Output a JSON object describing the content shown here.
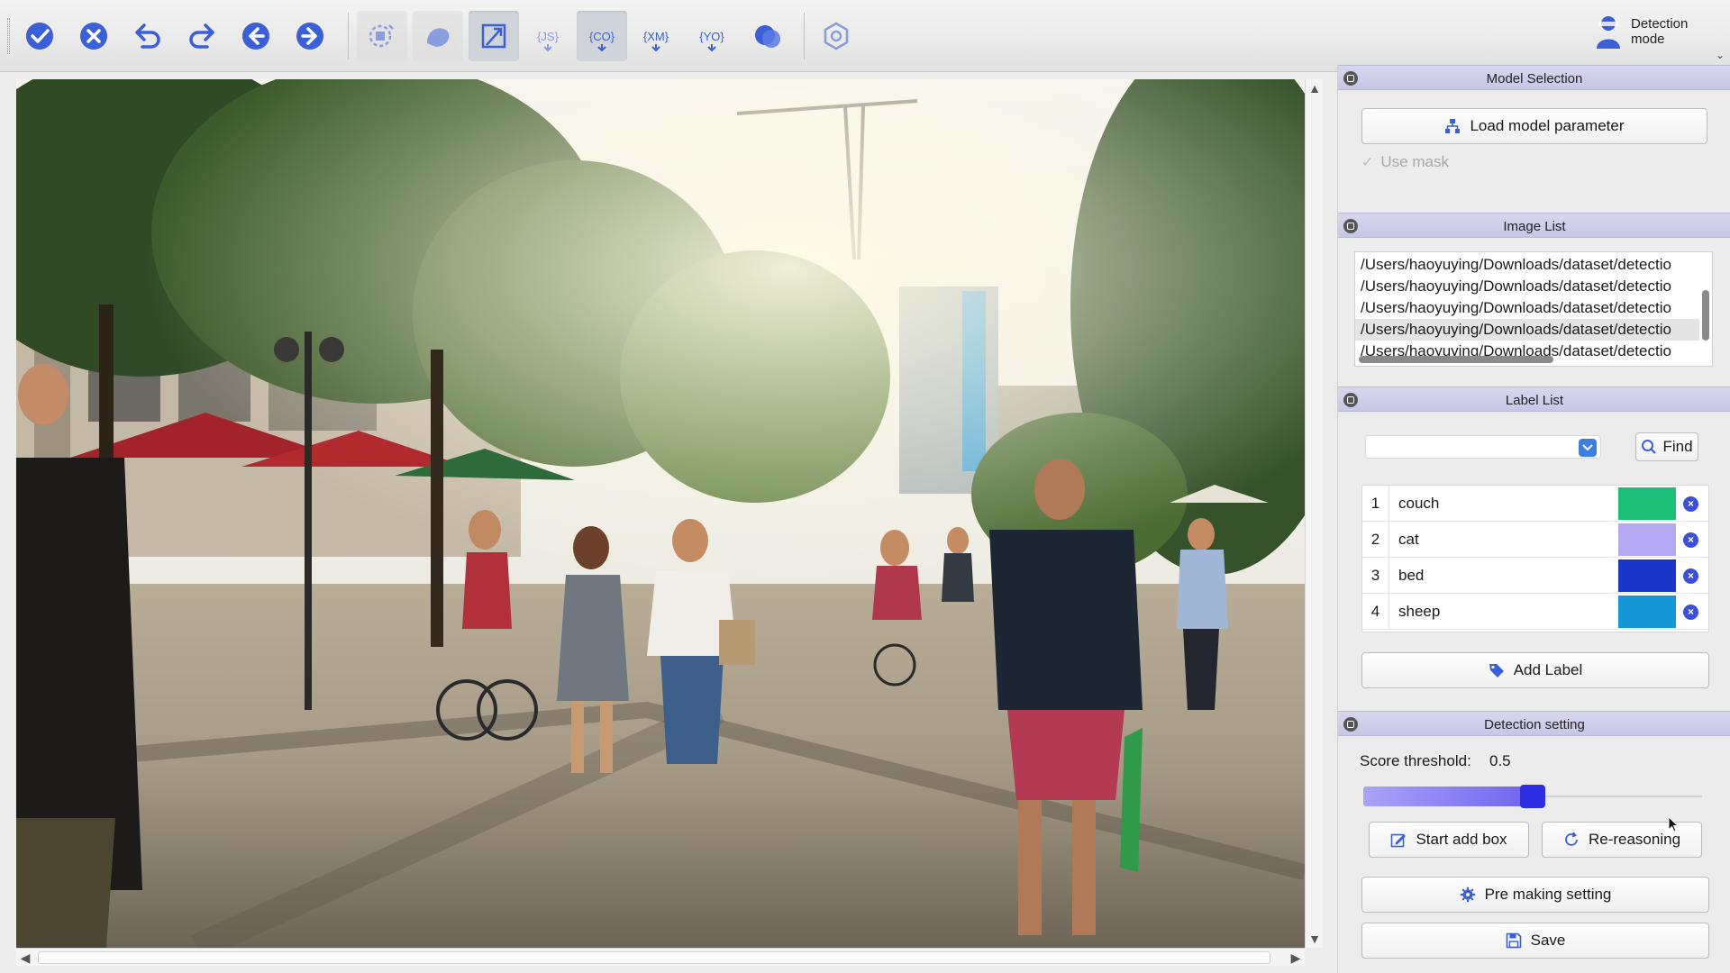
{
  "toolbar": {
    "buttons": [
      {
        "name": "confirm-icon"
      },
      {
        "name": "cancel-icon"
      },
      {
        "name": "undo-icon"
      },
      {
        "name": "redo-icon"
      },
      {
        "name": "previous-icon"
      },
      {
        "name": "next-icon"
      },
      {
        "name": "auto-label-icon"
      },
      {
        "name": "polygon-icon"
      },
      {
        "name": "crop-icon"
      },
      {
        "name": "json-export-icon",
        "text": "JS"
      },
      {
        "name": "coco-export-icon",
        "text": "CO"
      },
      {
        "name": "xml-export-icon",
        "text": "XM"
      },
      {
        "name": "yolo-export-icon",
        "text": "YO"
      },
      {
        "name": "mask-icon"
      },
      {
        "name": "settings-icon"
      }
    ],
    "mode": {
      "line1": "Detection",
      "line2": "mode",
      "icon": "person-icon"
    }
  },
  "model_selection": {
    "title": "Model Selection",
    "load_button": "Load model parameter",
    "use_mask": "Use mask"
  },
  "image_list": {
    "title": "Image List",
    "items": [
      "/Users/haoyuying/Downloads/dataset/detectio",
      "/Users/haoyuying/Downloads/dataset/detectio",
      "/Users/haoyuying/Downloads/dataset/detectio",
      "/Users/haoyuying/Downloads/dataset/detectio",
      "/Users/haoyuying/Downloads/dataset/detectio"
    ],
    "selected_index": 3
  },
  "label_list": {
    "title": "Label List",
    "find_button": "Find",
    "labels": [
      {
        "index": "1",
        "name": "couch",
        "color": "#1bbf7a"
      },
      {
        "index": "2",
        "name": "cat",
        "color": "#b4a9f2"
      },
      {
        "index": "3",
        "name": "bed",
        "color": "#1b35c9"
      },
      {
        "index": "4",
        "name": "sheep",
        "color": "#1497d4"
      }
    ],
    "add_button": "Add Label"
  },
  "detection_setting": {
    "title": "Detection setting",
    "score_label": "Score threshold:",
    "score_value": "0.5",
    "slider_fraction": 0.5,
    "start_box_button": "Start add box",
    "rereasoning_button": "Re-reasoning",
    "pre_making_button": "Pre making setting",
    "save_button": "Save"
  },
  "colors": {
    "accent": "#3b4fd8",
    "header": "#cdcbea",
    "toolbar_icon": "#3a5fd6"
  }
}
